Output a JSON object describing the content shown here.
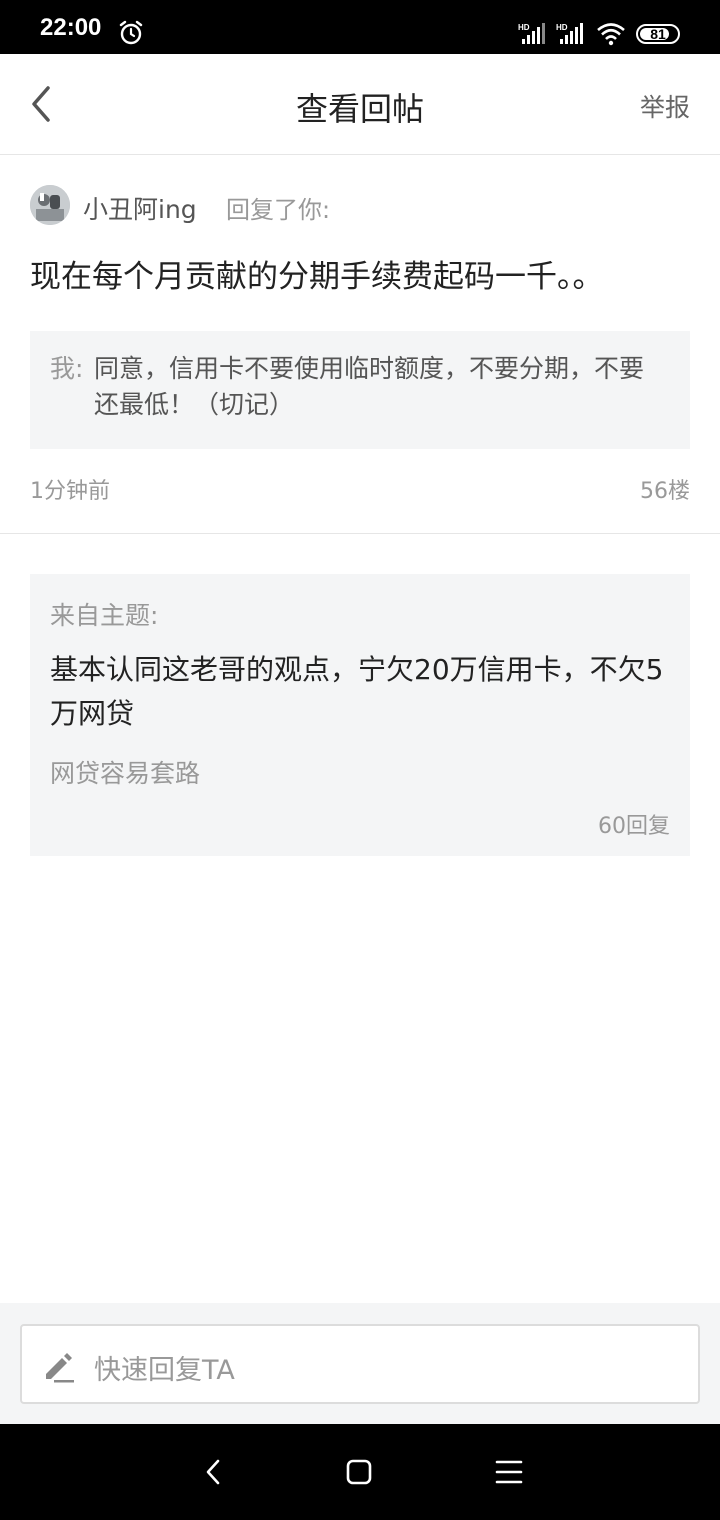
{
  "status_bar": {
    "time": "22:00",
    "battery": "81",
    "battery_fraction": 0.81,
    "icons": [
      "alarm-icon",
      "signal-hd-icon",
      "signal-hd-icon",
      "wifi-icon",
      "battery-icon"
    ]
  },
  "header": {
    "title": "查看回帖",
    "report_label": "举报",
    "back_icon": "chevron-left-icon"
  },
  "reply": {
    "author": "小丑阿ing",
    "action": "回复了你:",
    "content": "现在每个月贡献的分期手续费起码一千。。",
    "quote_prefix": "我:",
    "quote_text": "同意，信用卡不要使用临时额度，不要分期，不要还最低！（切记）",
    "time": "1分钟前",
    "floor": "56楼"
  },
  "topic": {
    "from_label": "来自主题:",
    "title": "基本认同这老哥的观点，宁欠20万信用卡，不欠5万网贷",
    "subtitle": "网贷容易套路",
    "reply_count": "60回复"
  },
  "quick_reply": {
    "placeholder": "快速回复TA",
    "icon": "pencil-icon"
  },
  "nav_bar": {
    "icons": [
      "nav-back-icon",
      "nav-home-icon",
      "nav-menu-icon"
    ]
  },
  "colors": {
    "status_bar_bg": "#000000",
    "page_bg": "#ffffff",
    "card_bg": "#f4f5f6",
    "primary_text": "#222222",
    "secondary_text": "#999999"
  }
}
